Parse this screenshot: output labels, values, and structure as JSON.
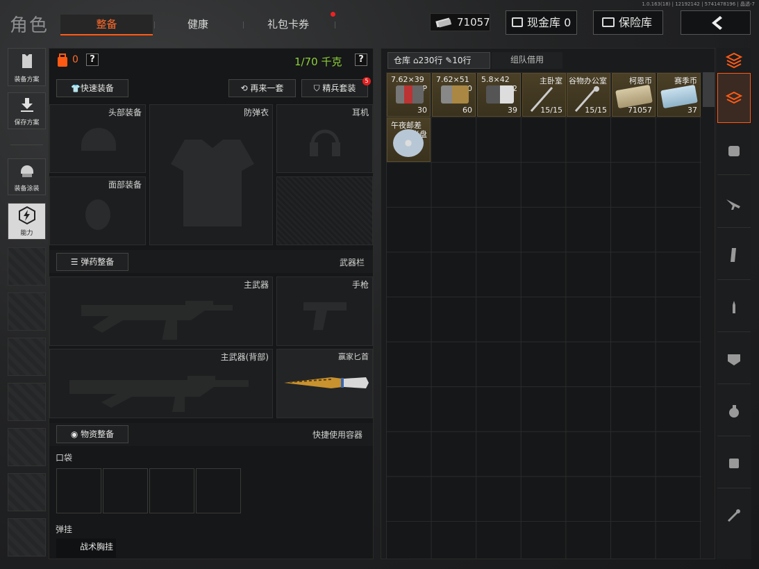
{
  "version": "1.0.163(18) | 12192142 | 5741478196 | 晶透-7",
  "header": {
    "title": "角色",
    "tabs": [
      {
        "label": "整备"
      },
      {
        "label": "健康"
      },
      {
        "label": "礼包卡券"
      }
    ],
    "money": "71057",
    "cash_vault": "现金库 0",
    "insurance": "保险库"
  },
  "rail": {
    "items": [
      {
        "label": "装备方案",
        "icon": "vest-icon"
      },
      {
        "label": "保存方案",
        "icon": "download-icon"
      },
      {
        "label": "装备涂装",
        "icon": "helmet-icon"
      },
      {
        "label": "能力",
        "icon": "ability-icon"
      }
    ]
  },
  "loadout": {
    "backpack_count": "0",
    "weight": "1/70 千克",
    "quick_equip": "快速装备",
    "again": "再来一套",
    "elite": "精兵套装",
    "elite_badge": "5",
    "slots": {
      "head": "头部装备",
      "armor": "防弹衣",
      "ear": "耳机",
      "face": "面部装备"
    },
    "ammo_btn": "弹药整备",
    "weapon_bar": "武器栏",
    "weapons": {
      "primary": "主武器",
      "pistol": "手枪",
      "primary_back": "主武器(背部)",
      "melee": "赢家匕首"
    },
    "supply_btn": "物资整备",
    "quick_container": "快捷使用容器",
    "pocket": "口袋",
    "rig": "弹挂",
    "rig_item": "战术胸挂"
  },
  "warehouse": {
    "tab_warehouse": "仓库",
    "rows_home": "230行",
    "rows_tag": "10行",
    "team_borrow": "组队借用",
    "items": [
      {
        "title": "7.62×39",
        "sub": "BP",
        "count": "30"
      },
      {
        "title": "7.62×51",
        "sub": "M80",
        "count": "60"
      },
      {
        "title": "5.8×42",
        "sub": "DVC12",
        "count": "39"
      },
      {
        "title": "主卧室",
        "sub": "",
        "count": "15/15"
      },
      {
        "title": "谷物办公室",
        "sub": "",
        "count": "15/15"
      },
      {
        "title": "柯恩币",
        "sub": "",
        "count": "71057"
      },
      {
        "title": "赛季币",
        "sub": "",
        "count": "37"
      },
      {
        "title": "午夜邮差",
        "sub": "光盘",
        "count": ""
      }
    ]
  },
  "side_tabs": [
    "stack-icon",
    "layers-icon",
    "backpack-icon",
    "rifle-icon",
    "magazine-icon",
    "bullet-icon",
    "armor-plate-icon",
    "grenade-icon",
    "supplies-icon",
    "key-icon"
  ]
}
